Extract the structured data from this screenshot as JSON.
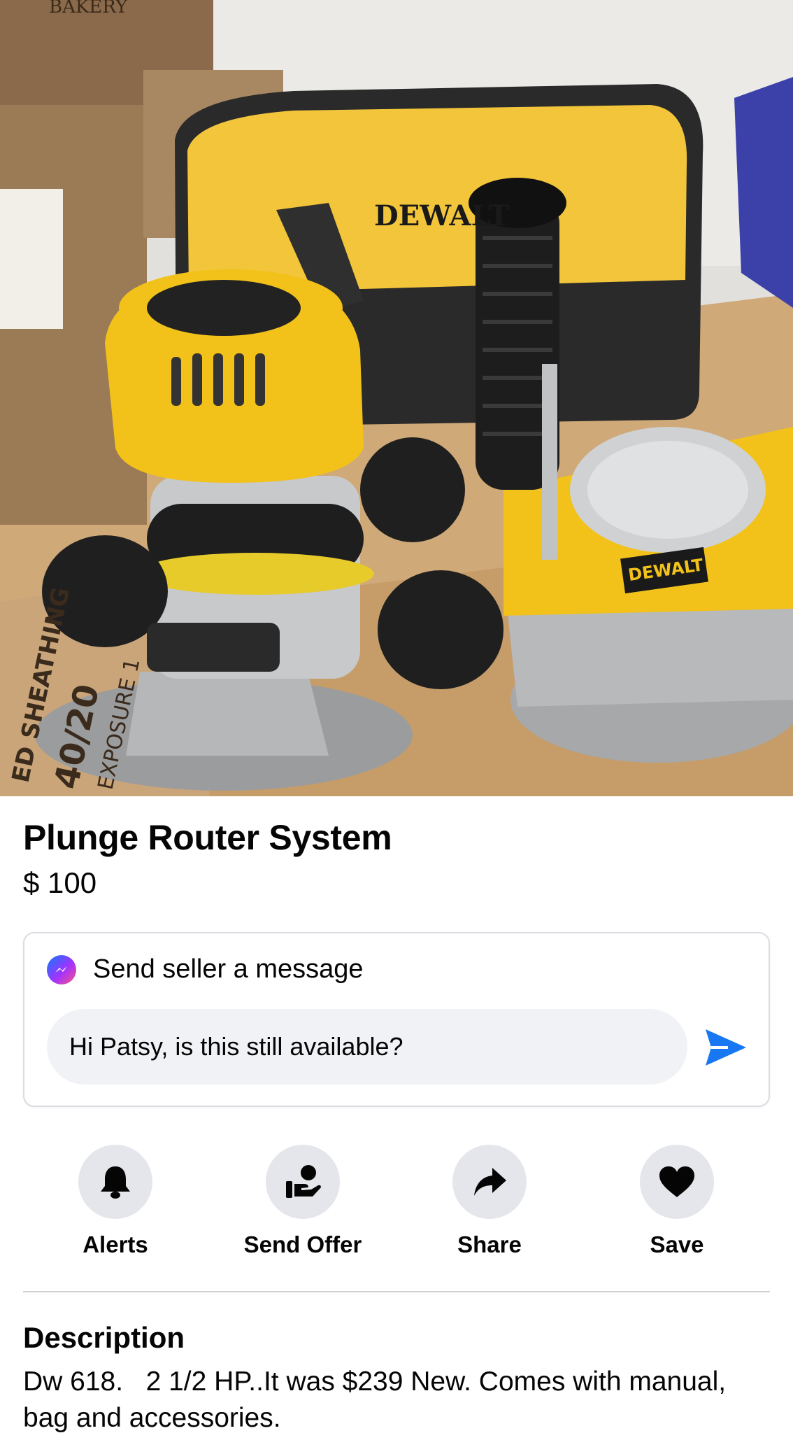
{
  "listing": {
    "title": "Plunge Router System",
    "price": "$ 100",
    "photo": {
      "brand_text": "DEWALT",
      "box_text_1": "BAKERY",
      "box_text_2": "ED SHEATHING",
      "box_text_3": "40/20",
      "box_text_4": "EXPOSURE 1"
    }
  },
  "message": {
    "header": "Send seller a message",
    "input_value": "Hi Patsy, is this still available?",
    "header_icon": "messenger-icon",
    "send_icon": "send-arrow-icon"
  },
  "actions": [
    {
      "label": "Alerts",
      "icon": "bell-icon"
    },
    {
      "label": "Send Offer",
      "icon": "offer-hand-icon"
    },
    {
      "label": "Share",
      "icon": "share-arrow-icon"
    },
    {
      "label": "Save",
      "icon": "heart-icon"
    }
  ],
  "description": {
    "title": "Description",
    "body": "Dw 618.   2 1/2 HP..It was $239 New. Comes with manual, bag and accessories."
  },
  "colors": {
    "accent": "#1877f2",
    "dewalt_yellow": "#f2c21b",
    "action_circle": "#e4e6eb",
    "input_bg": "#f0f2f5"
  }
}
